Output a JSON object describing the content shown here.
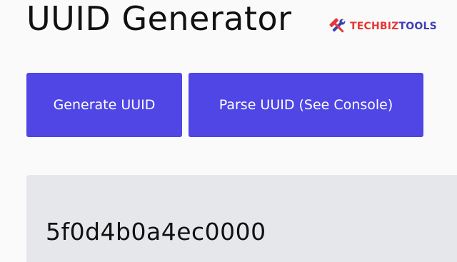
{
  "header": {
    "title": "UUID Generator",
    "logo": {
      "icon": "tools-icon",
      "text_part1": "TECHBIZ",
      "text_part2": "TOOLS"
    }
  },
  "actions": {
    "generate_label": "Generate UUID",
    "parse_label": "Parse UUID (See Console)"
  },
  "output": {
    "value": "5f0d4b0a4ec0000"
  },
  "colors": {
    "accent": "#4f46e5",
    "output_background": "#e5e7eb",
    "page_background": "#fafafa",
    "logo_red": "#e53935",
    "logo_blue": "#3f3fb8"
  }
}
